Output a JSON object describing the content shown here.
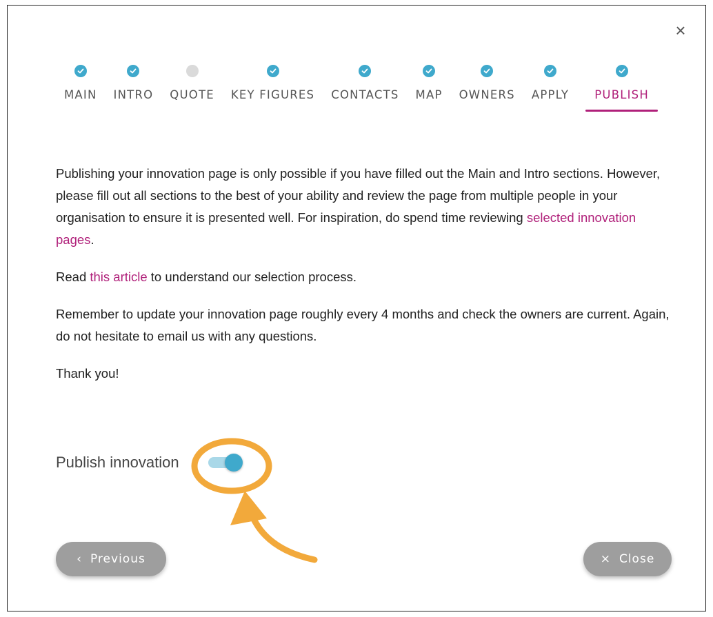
{
  "close_icon_glyph": "×",
  "steps": [
    {
      "label": "MAIN",
      "done": true
    },
    {
      "label": "INTRO",
      "done": true
    },
    {
      "label": "QUOTE",
      "done": false
    },
    {
      "label": "KEY FIGURES",
      "done": true
    },
    {
      "label": "CONTACTS",
      "done": true
    },
    {
      "label": "MAP",
      "done": true
    },
    {
      "label": "OWNERS",
      "done": true
    },
    {
      "label": "APPLY",
      "done": true
    },
    {
      "label": "PUBLISH",
      "done": true,
      "active": true
    }
  ],
  "content": {
    "p1_text": "Publishing your innovation page is only possible if you have filled out the Main and Intro sections. However, please fill out all sections to the best of your ability and review the page from multiple people in your organisation to ensure it is presented well. For inspiration, do spend time reviewing ",
    "p1_link": "selected innovation pages",
    "p1_end": ".",
    "p2_before": "Read ",
    "p2_link": "this article",
    "p2_after": " to understand our selection process.",
    "p3_text": "Remember to update your innovation page roughly every 4 months and check the owners are current. Again, do not hesitate to email us with any questions.",
    "p4_text": "Thank you!"
  },
  "publish": {
    "label": "Publish innovation",
    "enabled": true
  },
  "buttons": {
    "previous_icon": "‹",
    "previous_label": "Previous",
    "close_icon": "×",
    "close_label": "Close"
  },
  "colors": {
    "accent": "#b0207a",
    "step_done": "#3fa9cc",
    "step_pending": "#dadada",
    "annotation": "#f2a93b",
    "button_bg": "#9e9e9e"
  }
}
